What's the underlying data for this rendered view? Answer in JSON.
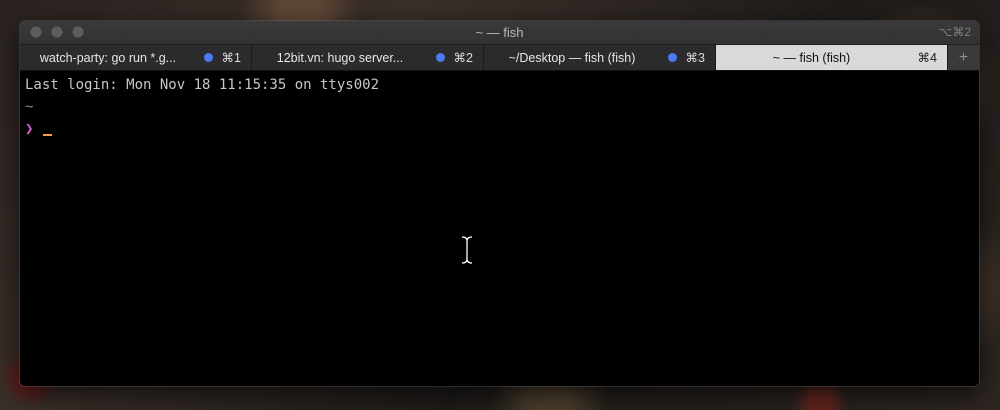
{
  "window": {
    "title": "~ — fish",
    "shortcut": "⌥⌘2"
  },
  "tabs": [
    {
      "label": "watch-party: go run *.g...",
      "key": "⌘1",
      "active": false,
      "dot": true
    },
    {
      "label": "12bit.vn: hugo server...",
      "key": "⌘2",
      "active": false,
      "dot": true
    },
    {
      "label": "~/Desktop — fish (fish)",
      "key": "⌘3",
      "active": false,
      "dot": true
    },
    {
      "label": "~ — fish (fish)",
      "key": "⌘4",
      "active": true,
      "dot": false
    }
  ],
  "tab_add_label": "+",
  "terminal": {
    "last_login": "Last login: Mon Nov 18 11:15:35 on ttys002",
    "cwd": "~",
    "prompt_symbol": "❯"
  },
  "colors": {
    "accent_dot": "#4d7cf0",
    "prompt": "#d65fd5",
    "cursor": "#f1a23a"
  }
}
